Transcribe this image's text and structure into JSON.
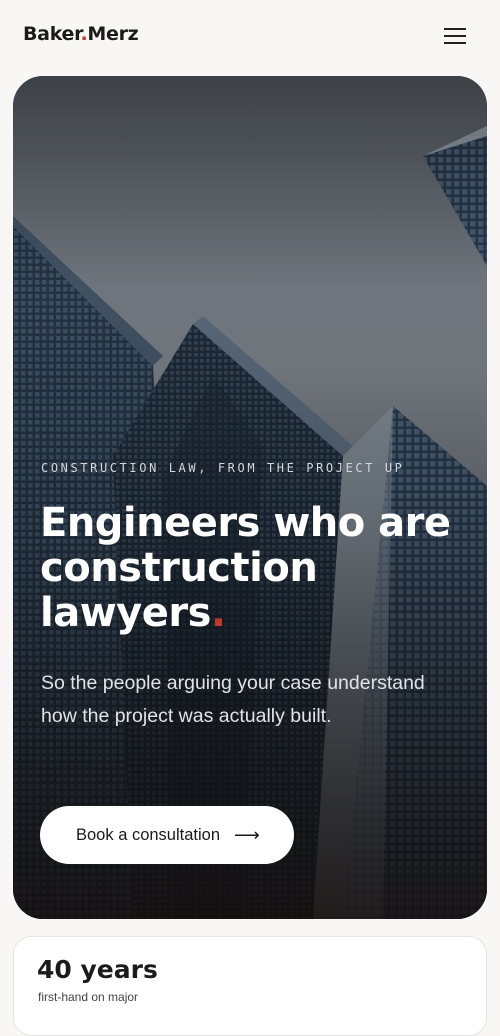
{
  "header": {
    "logo_part1": "Baker",
    "logo_dot": ".",
    "logo_part2": "Merz",
    "menu_icon": "hamburger-menu-icon"
  },
  "hero": {
    "eyebrow": "CONSTRUCTION LAW, FROM THE PROJECT UP",
    "headline_line1": "Engineers who are",
    "headline_line2": "construction",
    "headline_line3": "lawyers",
    "headline_dot": ".",
    "subtext": "So the people arguing your case understand how the project was actually built.",
    "cta_label": "Book a consultation",
    "cta_arrow": "⟶",
    "background_image": "skyscrapers-looking-up-photo"
  },
  "stats": {
    "value": "40 years",
    "label": "first-hand on major"
  },
  "colors": {
    "accent": "#c0392b",
    "page_bg": "#f8f7f5",
    "text_dark": "#1b1b1b",
    "button_bg": "#ffffff"
  }
}
